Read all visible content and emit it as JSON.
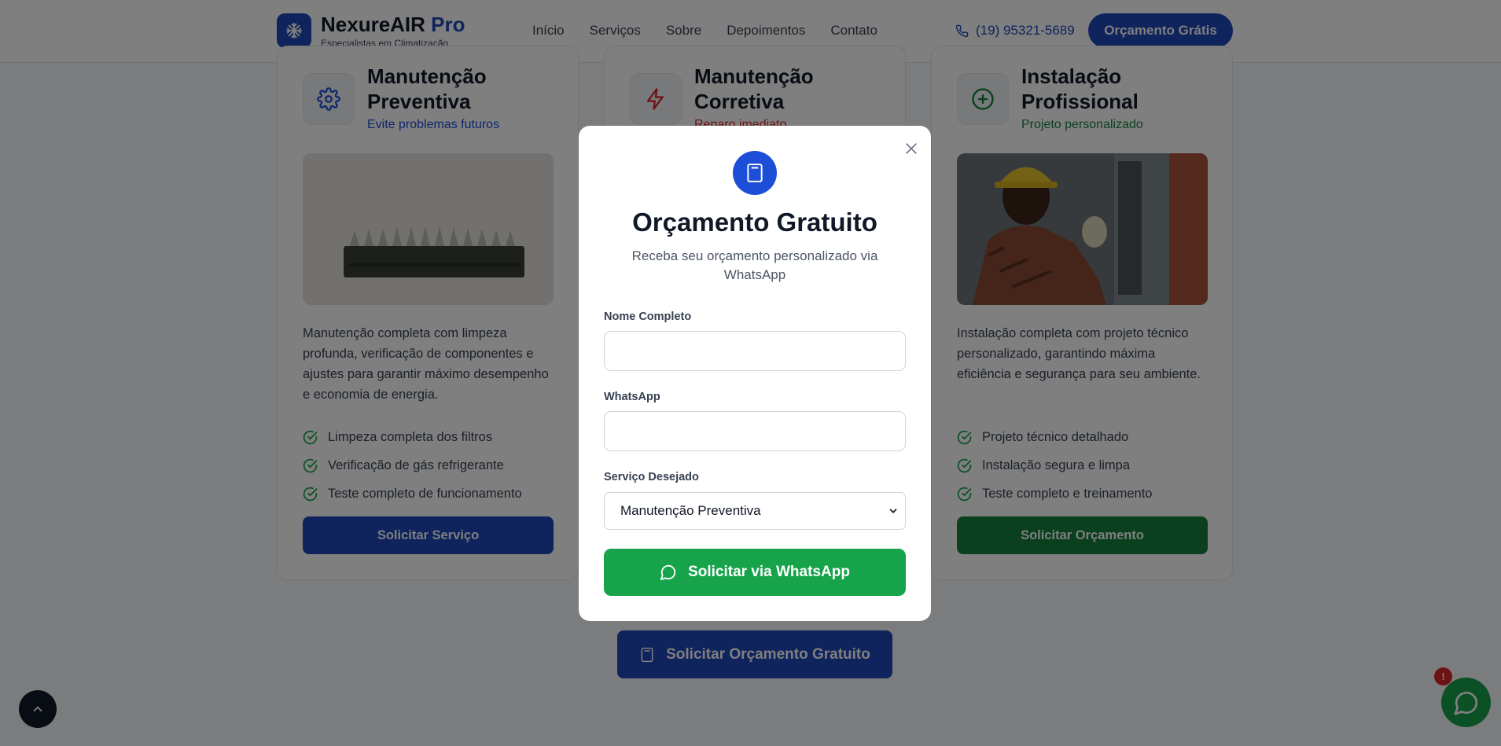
{
  "header": {
    "brand": "NexureAIR",
    "brand_suffix": "Pro",
    "tagline": "Especialistas em Climatização",
    "nav": [
      {
        "label": "Início"
      },
      {
        "label": "Serviços"
      },
      {
        "label": "Sobre"
      },
      {
        "label": "Depoimentos"
      },
      {
        "label": "Contato"
      }
    ],
    "phone": "(19) 95321-5689",
    "cta_label": "Orçamento Grátis"
  },
  "cards": [
    {
      "title": "Manutenção Preventiva",
      "subtitle": "Evite problemas futuros",
      "subtitle_color": "#1d4ed8",
      "icon": "gear-icon",
      "description": "Manutenção completa com limpeza profunda, verificação de componentes e ajustes para garantir máximo desempenho e economia de energia.",
      "features": [
        "Limpeza completa dos filtros",
        "Verificação de gás refrigerante",
        "Teste completo de funcionamento"
      ],
      "button": "Solicitar Serviço",
      "button_color": "#1e47b8"
    },
    {
      "title": "Manutenção Corretiva",
      "subtitle": "Reparo imediato",
      "subtitle_color": "#dc2626",
      "icon": "lightning-icon"
    },
    {
      "title": "Instalação Profissional",
      "subtitle": "Projeto personalizado",
      "subtitle_color": "#15803d",
      "icon": "plus-circle-icon",
      "description": "Instalação completa com projeto técnico personalizado, garantindo máxima eficiência e segurança para seu ambiente.",
      "features": [
        "Projeto técnico detalhado",
        "Instalação segura e limpa",
        "Teste completo e treinamento"
      ],
      "button": "Solicitar Orçamento",
      "button_color": "#15803d"
    }
  ],
  "bottom_cta": "Solicitar Orçamento Gratuito",
  "chat_badge": "!",
  "modal": {
    "title": "Orçamento Gratuito",
    "subtitle": "Receba seu orçamento personalizado via WhatsApp",
    "fields": {
      "name_label": "Nome Completo",
      "name_value": "",
      "whatsapp_label": "WhatsApp",
      "whatsapp_value": "",
      "service_label": "Serviço Desejado",
      "service_selected": "Manutenção Preventiva"
    },
    "submit": "Solicitar via WhatsApp"
  },
  "colors": {
    "primary": "#1e47b8",
    "whatsapp_green": "#16a34a",
    "alert_red": "#dc2626"
  }
}
